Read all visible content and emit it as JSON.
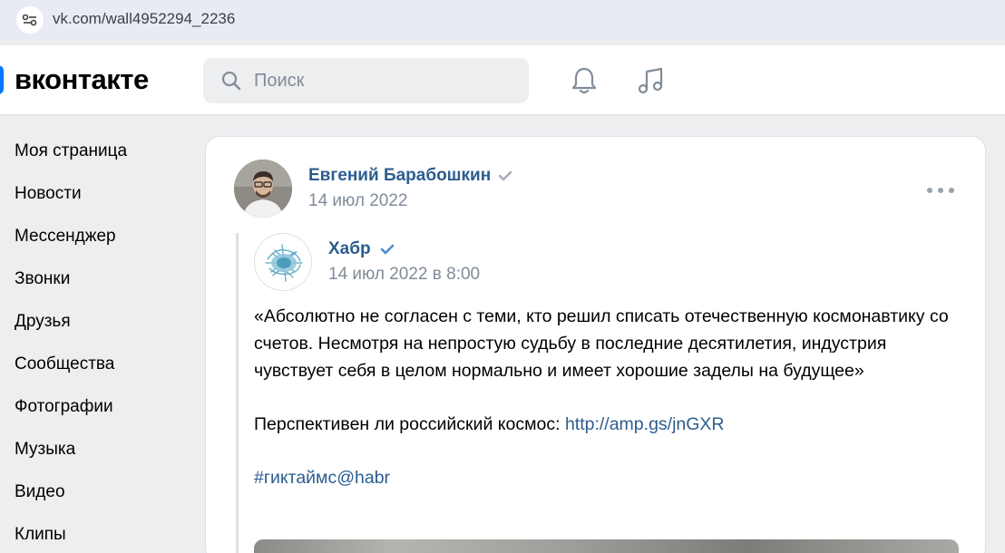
{
  "browser": {
    "url": "vk.com/wall4952294_2236"
  },
  "header": {
    "logo_text": "вконтакте",
    "search_placeholder": "Поиск"
  },
  "sidebar": {
    "items": [
      {
        "label": "Моя страница"
      },
      {
        "label": "Новости"
      },
      {
        "label": "Мессенджер"
      },
      {
        "label": "Звонки"
      },
      {
        "label": "Друзья"
      },
      {
        "label": "Сообщества"
      },
      {
        "label": "Фотографии"
      },
      {
        "label": "Музыка"
      },
      {
        "label": "Видео"
      },
      {
        "label": "Клипы"
      }
    ]
  },
  "post": {
    "author": "Евгений Барабошкин",
    "date": "14 июл 2022",
    "repost": {
      "author": "Хабр",
      "date": "14 июл 2022 в 8:00",
      "quote": "«Абсолютно не согласен с теми, кто решил списать отечественную космонавтику со счетов. Несмотря на непростую судьбу в последние десятилетия, индустрия чувствует себя в целом нормально и имеет хорошие заделы на будущее»",
      "question": "Перспективен ли российский космос: ",
      "link": "http://amp.gs/jnGXR",
      "hashtag": "#гиктаймс@habr"
    }
  },
  "colors": {
    "accent": "#0077ff",
    "link": "#2c5d8f",
    "secondary_text": "#818c99",
    "background": "#edeef0"
  }
}
